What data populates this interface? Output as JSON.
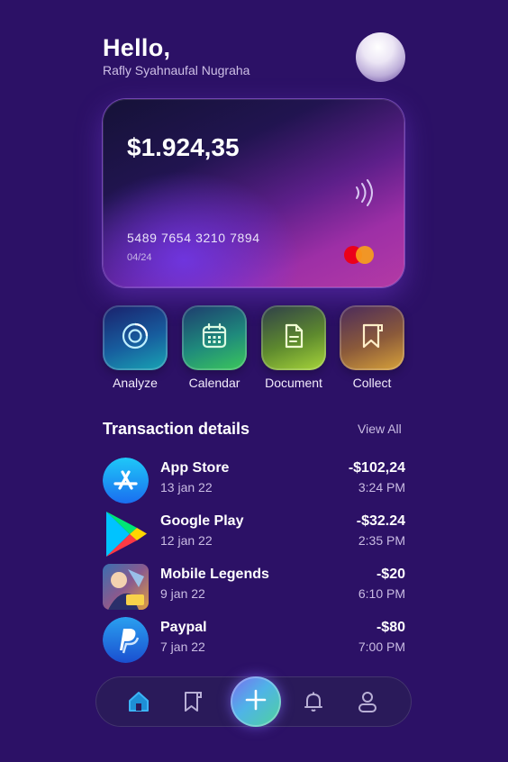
{
  "header": {
    "greeting": "Hello,",
    "username": "Rafly Syahnaufal Nugraha"
  },
  "card": {
    "balance": "$1.924,35",
    "number": "5489 7654 3210 7894",
    "expiry": "04/24"
  },
  "actions": [
    {
      "label": "Analyze",
      "icon": "analyze-icon"
    },
    {
      "label": "Calendar",
      "icon": "calendar-icon"
    },
    {
      "label": "Document",
      "icon": "document-icon"
    },
    {
      "label": "Collect",
      "icon": "collect-icon"
    }
  ],
  "transactions": {
    "title": "Transaction details",
    "view_all": "View All",
    "items": [
      {
        "name": "App Store",
        "date": "13 jan 22",
        "amount": "-$102,24",
        "time": "3:24 PM",
        "icon": "app-store-icon"
      },
      {
        "name": "Google Play",
        "date": "12 jan 22",
        "amount": "-$32.24",
        "time": "2:35 PM",
        "icon": "google-play-icon"
      },
      {
        "name": "Mobile Legends",
        "date": "9 jan 22",
        "amount": "-$20",
        "time": "6:10 PM",
        "icon": "mobile-legends-icon"
      },
      {
        "name": "Paypal",
        "date": "7 jan 22",
        "amount": "-$80",
        "time": "7:00 PM",
        "icon": "paypal-icon"
      }
    ]
  },
  "nav": {
    "items": [
      "home-icon",
      "bookmark-icon",
      "plus-icon",
      "bell-icon",
      "user-icon"
    ],
    "active": "home-icon"
  },
  "colors": {
    "background": "#2c1166",
    "accent": "#7b6cf0"
  }
}
